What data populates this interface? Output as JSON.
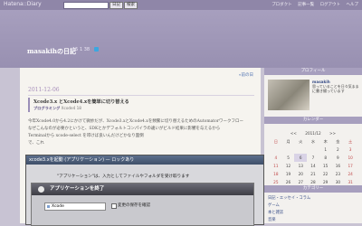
{
  "topbar": {
    "logo": "Hatena::Diary",
    "search_button": "日記",
    "search_button2": "検索",
    "links": [
      "プロダクト",
      "記事一覧",
      "ログアウト",
      "ヘルプ"
    ]
  },
  "header": {
    "title": "masakihの日記",
    "meta": "15 1 38"
  },
  "entry": {
    "prev_link": "«前の日",
    "date": "2011-12-06",
    "title": "Xcode3.x とXcode4.xを簡単に切り替える",
    "category_label": "プログラミング",
    "category_rest": " Xcode4 18",
    "lines": [
      "今年Xcode4.0から4.2にかけて微妙だが、Xcode3.xとXcode4.xを頻繁に切り替えるためのAutomatorワークフロー",
      "なぜこんなのが必要かというと、SDKとかデフォルトコンパイラの違いがビルド結果に影響を与えるから",
      "Terminalから xcode-select を叩けば良いんだけどかなり面倒",
      "で、これ"
    ]
  },
  "dialog": {
    "title": "xcode3.xを起動 (アプリケーション) — ロックあり",
    "message": "\"アプリケーション\"は、入力としてファイルやフォルダを受け取ります",
    "inner_title": "アプリケーションを終了",
    "select_value": "Xcode",
    "checkbox_label": "変更の保存を確認"
  },
  "sidebar": {
    "profile_header": "プロフィール",
    "profile_name": "masakih",
    "profile_desc": "思っていることを日々気ままに書き綴っています",
    "calendar_header": "カレンダー",
    "calendar_month": "2011/12",
    "calendar_nav_prev": "<<",
    "calendar_nav_next": ">>",
    "weekdays": [
      "日",
      "月",
      "火",
      "水",
      "木",
      "金",
      "土"
    ],
    "weeks": [
      [
        "",
        "",
        "",
        "",
        "1",
        "2",
        "3"
      ],
      [
        "4",
        "5",
        "6",
        "7",
        "8",
        "9",
        "10"
      ],
      [
        "11",
        "12",
        "13",
        "14",
        "15",
        "16",
        "17"
      ],
      [
        "18",
        "19",
        "20",
        "21",
        "22",
        "23",
        "24"
      ],
      [
        "25",
        "26",
        "27",
        "28",
        "29",
        "30",
        "31"
      ]
    ],
    "category_header": "カテゴリー",
    "categories": [
      "日記・エッセイ・コラム",
      "ゲーム",
      "本と雑誌",
      "音楽"
    ]
  }
}
